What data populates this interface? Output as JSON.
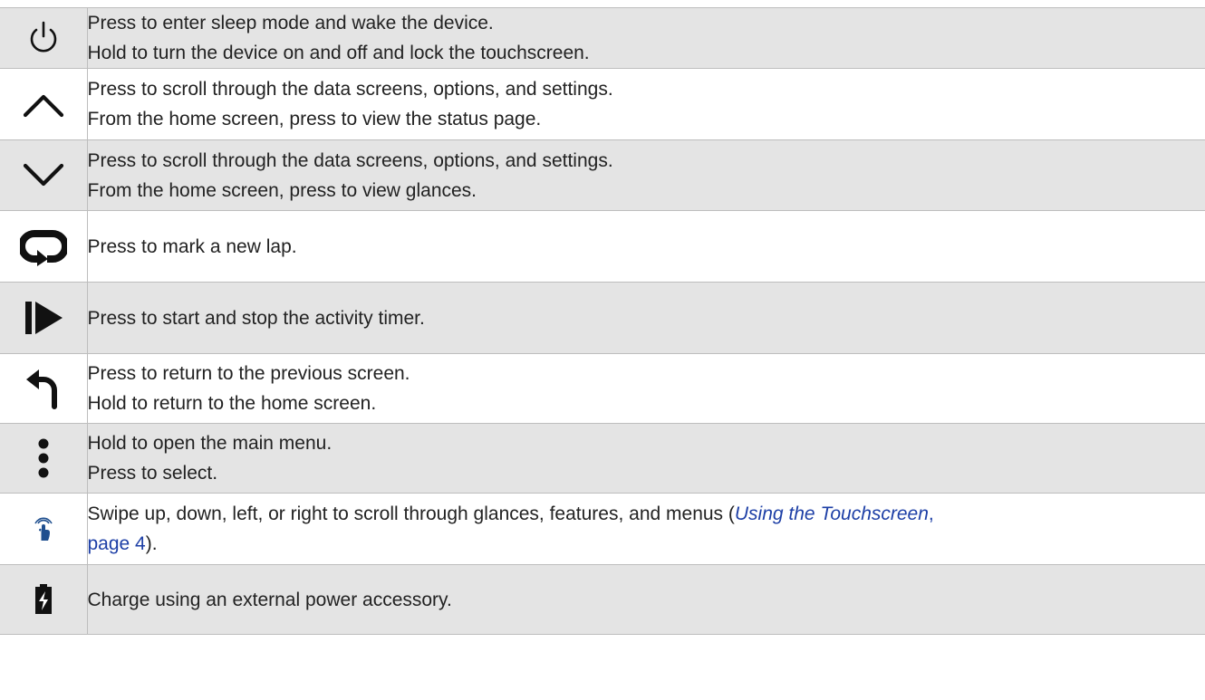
{
  "rows": [
    {
      "icon": "power-icon",
      "lines": [
        "Press to enter sleep mode and wake the device.",
        "Hold to turn the device on and off and lock the touchscreen."
      ]
    },
    {
      "icon": "chevron-up-icon",
      "lines": [
        "Press to scroll through the data screens, options, and settings.",
        "From the home screen, press to view the status page."
      ]
    },
    {
      "icon": "chevron-down-icon",
      "lines": [
        "Press to scroll through the data screens, options, and settings.",
        "From the home screen, press to view glances."
      ]
    },
    {
      "icon": "lap-icon",
      "lines": [
        "Press to mark a new lap."
      ]
    },
    {
      "icon": "start-stop-icon",
      "lines": [
        "Press to start and stop the activity timer."
      ]
    },
    {
      "icon": "back-icon",
      "lines": [
        "Press to return to the previous screen.",
        "Hold to return to the home screen."
      ]
    },
    {
      "icon": "menu-dots-icon",
      "lines": [
        "Hold to open the main menu.",
        "Press to select."
      ]
    },
    {
      "icon": "swipe-touch-icon",
      "text_before": "Swipe up, down, left, or right to scroll through glances, features, and menus (",
      "link_title": "Using the Touchscreen",
      "link_sep": ",",
      "link_page": "page 4",
      "text_after": ")."
    },
    {
      "icon": "charge-icon",
      "lines": [
        "Charge using an external power accessory."
      ]
    }
  ],
  "colors": {
    "shade": "#e4e4e4",
    "border": "#bdbdbd",
    "link": "#1d3fa6",
    "text": "#222222",
    "icon": "#111111"
  }
}
